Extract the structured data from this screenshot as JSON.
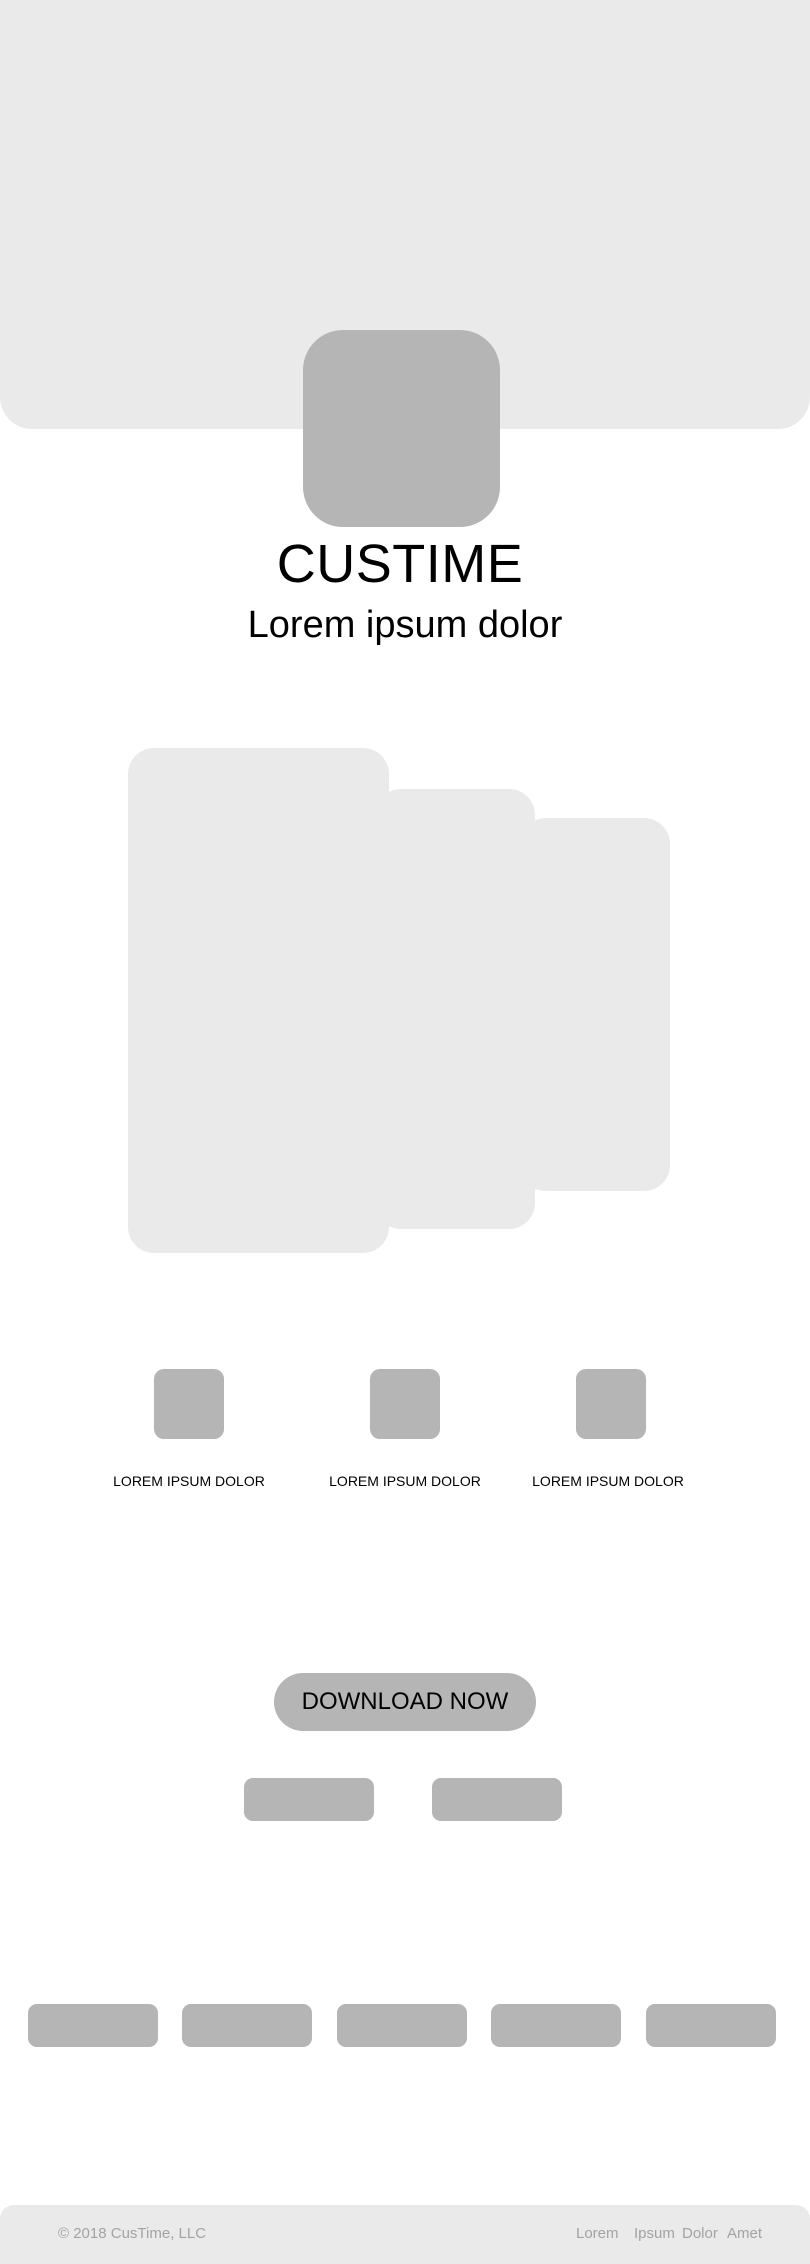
{
  "hero": {
    "app_name": "CUSTIME",
    "tagline": "Lorem ipsum dolor"
  },
  "features": [
    {
      "label": "LOREM IPSUM DOLOR"
    },
    {
      "label": "LOREM IPSUM DOLOR"
    },
    {
      "label": "LOREM IPSUM DOLOR"
    }
  ],
  "cta": {
    "download_label": "DOWNLOAD NOW"
  },
  "footer": {
    "copyright": "© 2018 CusTime, LLC",
    "links": [
      "Lorem",
      "Ipsum",
      "Dolor",
      "Amet"
    ]
  },
  "colors": {
    "placeholder_light": "#eaeaea",
    "placeholder_dark": "#b5b5b5",
    "footer_text": "#a3a3a3"
  }
}
